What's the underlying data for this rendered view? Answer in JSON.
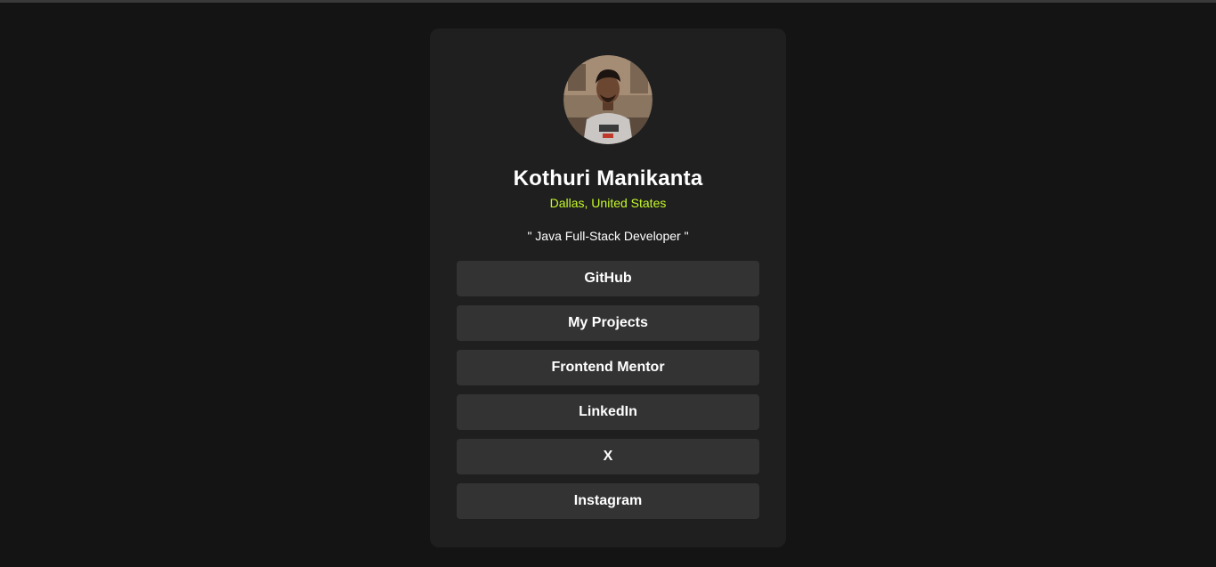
{
  "profile": {
    "name": "Kothuri Manikanta",
    "location": "Dallas, United States",
    "tagline": "\" Java Full-Stack Developer \""
  },
  "links": [
    {
      "label": "GitHub"
    },
    {
      "label": "My Projects"
    },
    {
      "label": "Frontend Mentor"
    },
    {
      "label": "LinkedIn"
    },
    {
      "label": "X"
    },
    {
      "label": "Instagram"
    }
  ],
  "colors": {
    "background": "#141414",
    "card": "#1f1f1f",
    "button": "#333333",
    "accent": "#c4f82a",
    "text": "#ffffff"
  }
}
